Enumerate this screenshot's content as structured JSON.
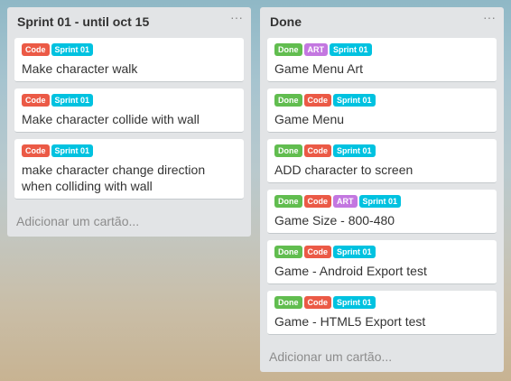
{
  "lists": [
    {
      "title": "Sprint 01 - until oct 15",
      "menu": "···",
      "add_card": "Adicionar um cartão...",
      "cards": [
        {
          "labels": [
            "Code",
            "Sprint 01"
          ],
          "title": "Make character walk"
        },
        {
          "labels": [
            "Code",
            "Sprint 01"
          ],
          "title": "Make character collide with wall"
        },
        {
          "labels": [
            "Code",
            "Sprint 01"
          ],
          "title": "make character change direction when colliding with wall"
        }
      ]
    },
    {
      "title": "Done",
      "menu": "···",
      "add_card": "Adicionar um cartão...",
      "cards": [
        {
          "labels": [
            "Done",
            "ART",
            "Sprint 01"
          ],
          "title": "Game Menu Art"
        },
        {
          "labels": [
            "Done",
            "Code",
            "Sprint 01"
          ],
          "title": "Game Menu"
        },
        {
          "labels": [
            "Done",
            "Code",
            "Sprint 01"
          ],
          "title": "ADD character to screen"
        },
        {
          "labels": [
            "Done",
            "Code",
            "ART",
            "Sprint 01"
          ],
          "title": "Game Size - 800-480"
        },
        {
          "labels": [
            "Done",
            "Code",
            "Sprint 01"
          ],
          "title": "Game - Android Export test"
        },
        {
          "labels": [
            "Done",
            "Code",
            "Sprint 01"
          ],
          "title": "Game - HTML5 Export test"
        }
      ]
    }
  ],
  "label_colors": {
    "Code": "#eb5a46",
    "Sprint 01": "#00c2e0",
    "Done": "#61bd4f",
    "ART": "#c377e0"
  }
}
